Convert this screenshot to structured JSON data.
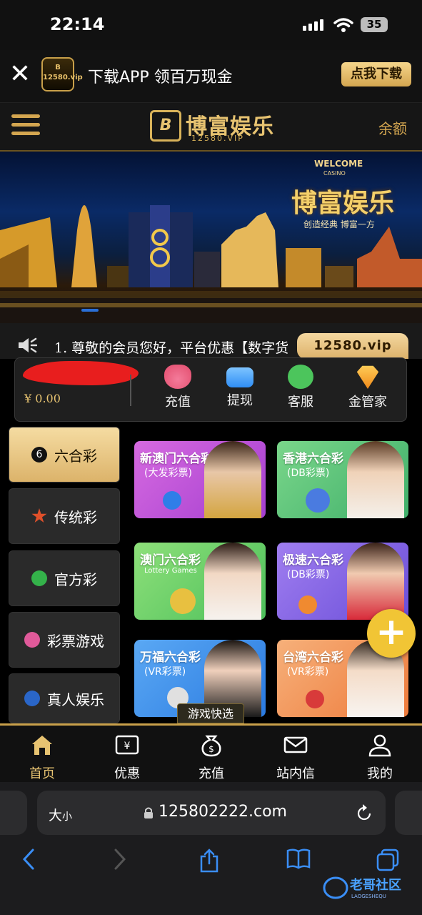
{
  "status_bar": {
    "time": "22:14",
    "battery": "35"
  },
  "download_banner": {
    "logo_text": "12580.vip",
    "text": "下载APP 领百万现金",
    "button": "点我下载"
  },
  "header": {
    "brand_name": "博富娱乐",
    "brand_sub": "12580.VIP",
    "balance_label": "余额"
  },
  "banner": {
    "welcome": "WELCOME",
    "casino": "CASINO",
    "title": "博富娱乐",
    "slogan": "创造经典 博富一方"
  },
  "notice": {
    "text": "1. 尊敬的会员您好，平台优惠【数字货",
    "domain": "12580.vip"
  },
  "wallet": {
    "balance": "¥ 0.00",
    "actions": [
      {
        "label": "充值",
        "icon": "money-bag-icon"
      },
      {
        "label": "提现",
        "icon": "card-icon"
      },
      {
        "label": "客服",
        "icon": "chat-icon"
      },
      {
        "label": "金管家",
        "icon": "diamond-icon"
      }
    ]
  },
  "categories": [
    {
      "label": "六合彩",
      "icon": "number-six-icon",
      "active": true
    },
    {
      "label": "传统彩",
      "icon": "star-icon",
      "active": false
    },
    {
      "label": "官方彩",
      "icon": "clover-icon",
      "active": false
    },
    {
      "label": "彩票游戏",
      "icon": "lottery-balls-icon",
      "active": false
    },
    {
      "label": "真人娱乐",
      "icon": "chip-icon",
      "active": false
    }
  ],
  "games": [
    {
      "title": "新澳门六合彩",
      "subtitle": "(大发彩票)",
      "color": "#c24bd6"
    },
    {
      "title": "香港六合彩",
      "subtitle": "(DB彩票)",
      "color": "#4cbf7a"
    },
    {
      "title": "澳门六合彩",
      "subtitle": "Lottery Games",
      "color": "#5cc46a"
    },
    {
      "title": "极速六合彩",
      "subtitle": "(DB彩票)",
      "color": "#7b5be0"
    },
    {
      "title": "万福六合彩",
      "subtitle": "(VR彩票)",
      "color": "#3a8fe8"
    },
    {
      "title": "台湾六合彩",
      "subtitle": "(VR彩票)",
      "color": "#f08a45"
    }
  ],
  "quick_pick": "游戏快选",
  "fab": "+",
  "nav": [
    {
      "label": "首页",
      "icon": "home-icon",
      "active": true
    },
    {
      "label": "优惠",
      "icon": "coupon-icon",
      "active": false
    },
    {
      "label": "充值",
      "icon": "money-bag-icon",
      "active": false
    },
    {
      "label": "站内信",
      "icon": "mail-icon",
      "active": false
    },
    {
      "label": "我的",
      "icon": "user-icon",
      "active": false
    }
  ],
  "safari": {
    "text_size": "大",
    "text_size_small": "小",
    "url": "125802222.com"
  },
  "watermark": {
    "text": "老哥社区",
    "sub": "LAOGESHEQU"
  },
  "colors": {
    "gold": "#d4a650",
    "accent_blue": "#2a6fd6",
    "fab_yellow": "#f1c535"
  }
}
